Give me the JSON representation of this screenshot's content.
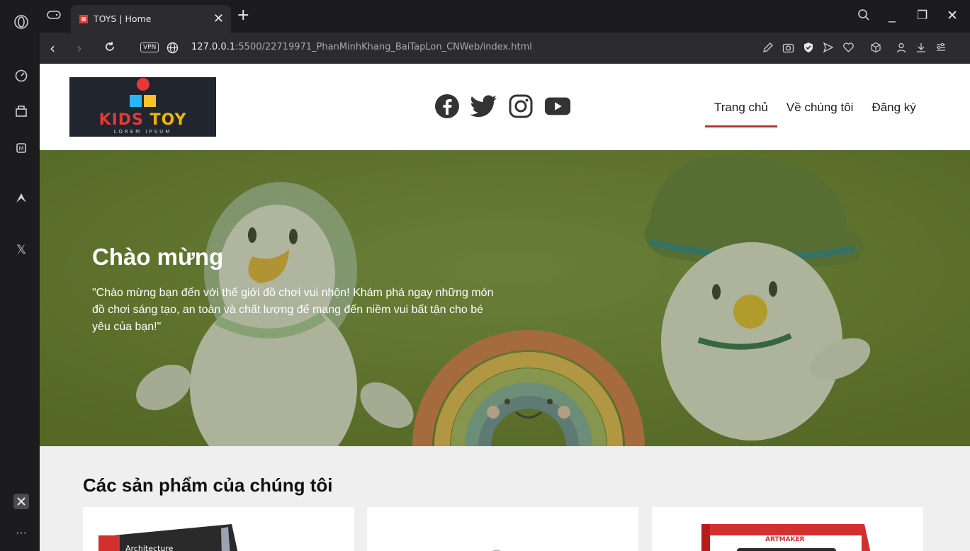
{
  "browser": {
    "tab_title": "TOYS | Home",
    "new_tab": "+",
    "url_host": "127.0.0.1",
    "url_rest": ":5500/22719971_PhanMinhKhang_BaiTapLon_CNWeb/index.html",
    "vpn_label": "VPN",
    "window_controls": {
      "minimize": "_",
      "restore": "❐",
      "close": "✕"
    }
  },
  "site": {
    "logo": {
      "main_kids": "KIDS",
      "main_toy": "TOY",
      "sub": "LOREM IPSUM"
    },
    "socials": [
      "facebook-icon",
      "twitter-icon",
      "instagram-icon",
      "youtube-icon"
    ],
    "nav": [
      {
        "label": "Trang chủ",
        "active": true
      },
      {
        "label": "Về chúng tôi",
        "active": false
      },
      {
        "label": "Đăng ký",
        "active": false
      }
    ],
    "hero": {
      "title": "Chào mừng",
      "text": "\"Chào mừng bạn đến với thế giới đồ chơi vui nhộn! Khám phá ngay những món đồ chơi sáng tạo, an toàn và chất lượng để mang đến niềm vui bất tận cho bé yêu của bạn!\""
    },
    "products": {
      "title": "Các sản phẩm của chúng tôi",
      "card1_brand": "Architecture",
      "card3_brand": "ARTMAKER"
    }
  },
  "colors": {
    "accent": "#c0392b",
    "hero_bg": "#667d32",
    "logo_bg": "#202530",
    "logo_kids": "#e53935",
    "logo_toy": "#f4b400"
  }
}
